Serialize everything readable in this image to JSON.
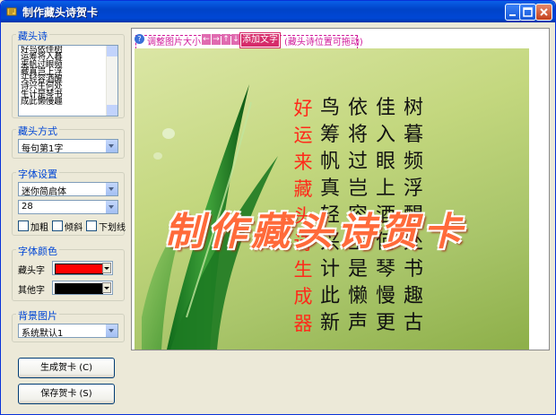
{
  "window": {
    "title": "制作藏头诗贺卡"
  },
  "left": {
    "poem_group": {
      "title": "藏头诗",
      "lines": [
        "好鸟依佳树",
        "运筹将入暮",
        "来帆过眼频",
        "藏真岂上浮",
        "头轻容酒醒",
        "诗兴生何处",
        "生计是琴书",
        "成此懒慢趣"
      ]
    },
    "mode_group": {
      "title": "藏头方式",
      "selected": "每句第1字"
    },
    "font_group": {
      "title": "字体设置",
      "font": "迷你简启体",
      "size": "28",
      "bold_label": "加粗",
      "italic_label": "倾斜",
      "underline_label": "下划线"
    },
    "color_group": {
      "title": "字体颜色",
      "head_label": "藏头字",
      "head_color": "#ff0000",
      "other_label": "其他字",
      "other_color": "#000000"
    },
    "bg_group": {
      "title": "背景图片",
      "selected": "系统默认1"
    },
    "generate_button": "生成贺卡 (C)",
    "save_button": "保存贺卡 (S)"
  },
  "preview": {
    "toolbar": {
      "help_icon": "?",
      "resize_label": "调整图片大小",
      "arrows": [
        "←",
        "→",
        "↑",
        "↓"
      ],
      "add_text_label": "添加文字",
      "drag_hint": "(藏头诗位置可拖动)"
    },
    "card": {
      "columns": [
        [
          "好",
          "运",
          "来",
          "藏",
          "头",
          "诗",
          "生",
          "成",
          "器"
        ],
        [
          "鸟",
          "筹",
          "帆",
          "真",
          "轻",
          "兴",
          "计",
          "此",
          "新"
        ],
        [
          "依",
          "将",
          "过",
          "岂",
          "容",
          "生",
          "是",
          "懒",
          "声"
        ],
        [
          "佳",
          "入",
          "眼",
          "上",
          "酒",
          "何",
          "琴",
          "慢",
          "更"
        ],
        [
          "树",
          "暮",
          "频",
          "浮",
          "醒",
          "处",
          "书",
          "趣",
          "古"
        ]
      ],
      "headline": "制作藏头诗贺卡",
      "head_color": "#ff2a1a",
      "body_color": "#111111"
    }
  }
}
